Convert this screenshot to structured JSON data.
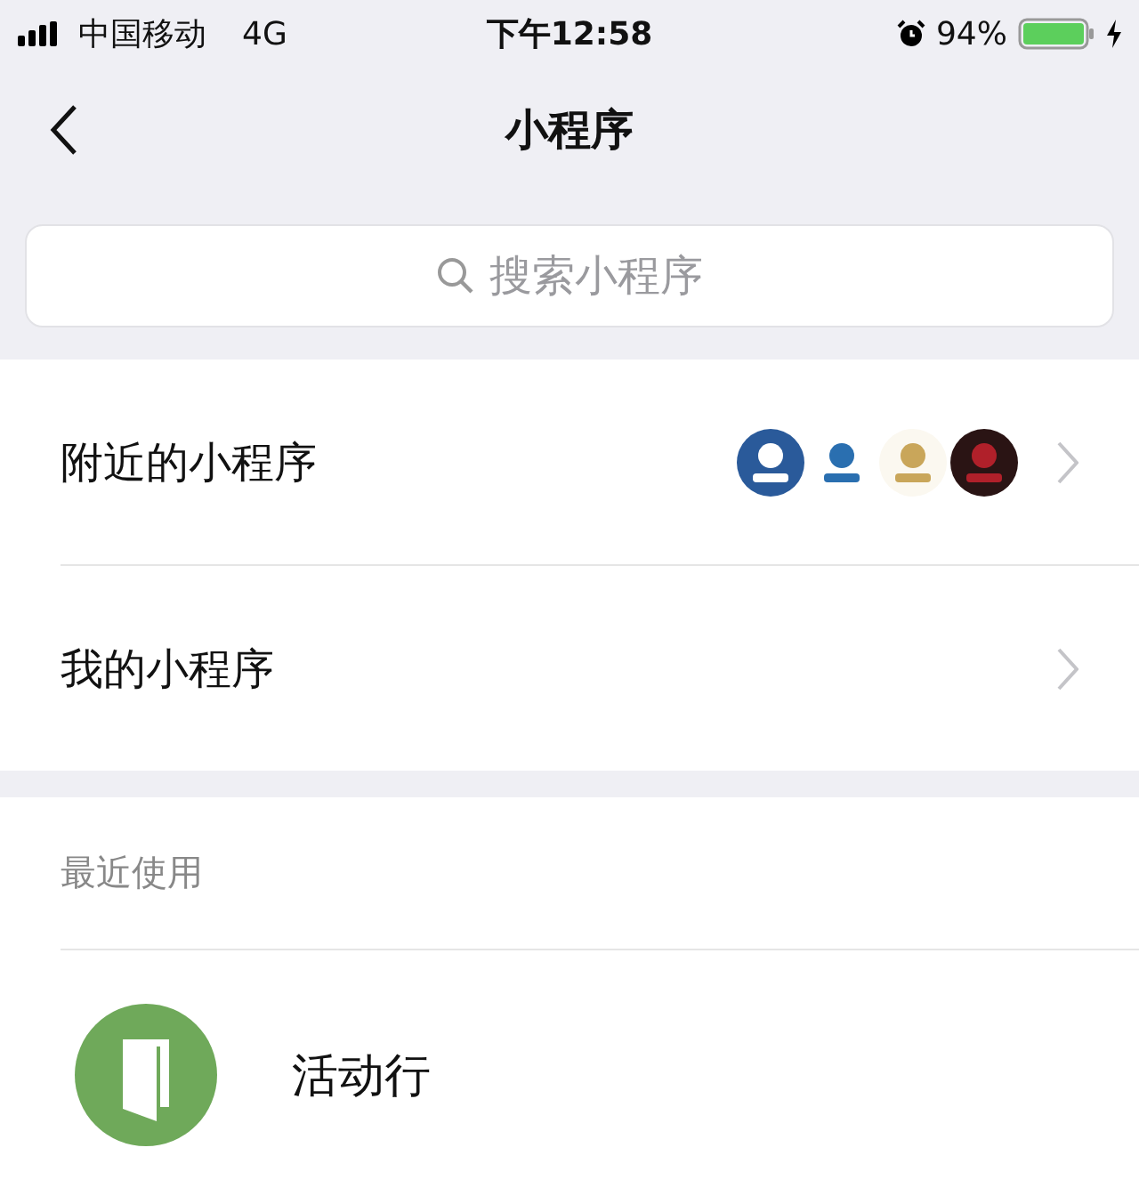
{
  "status_bar": {
    "carrier": "中国移动",
    "network": "4G",
    "time": "下午12:58",
    "battery": "94%"
  },
  "nav": {
    "title": "小程序"
  },
  "search": {
    "placeholder": "搜索小程序"
  },
  "menu": [
    {
      "label": "附近的小程序"
    },
    {
      "label": "我的小程序"
    }
  ],
  "recent": {
    "header": "最近使用",
    "items": [
      {
        "name": "活动行"
      }
    ]
  }
}
